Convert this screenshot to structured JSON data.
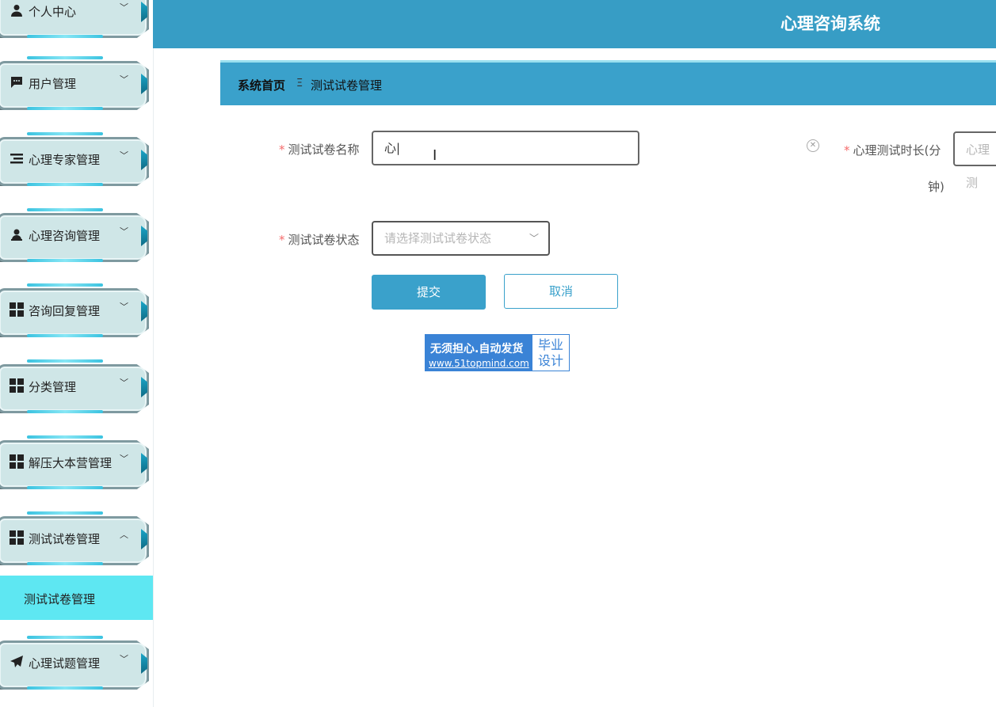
{
  "header": {
    "title": "心理咨询系统"
  },
  "breadcrumb": {
    "home": "系统首页",
    "separator": "Ξ",
    "current": "测试试卷管理"
  },
  "sidebar": {
    "items": [
      {
        "label": "个人中心",
        "icon": "person-icon",
        "arrow": "﹀"
      },
      {
        "label": "用户管理",
        "icon": "chat-icon",
        "arrow": "﹀"
      },
      {
        "label": "心理专家管理",
        "icon": "list-icon",
        "arrow": "﹀"
      },
      {
        "label": "心理咨询管理",
        "icon": "user-badge-icon",
        "arrow": "﹀"
      },
      {
        "label": "咨询回复管理",
        "icon": "grid-icon",
        "arrow": "﹀"
      },
      {
        "label": "分类管理",
        "icon": "grid-icon",
        "arrow": "﹀"
      },
      {
        "label": "解压大本营管理",
        "icon": "grid-icon",
        "arrow": "﹀"
      },
      {
        "label": "测试试卷管理",
        "icon": "grid-icon",
        "arrow": "︿"
      },
      {
        "label": "心理试题管理",
        "icon": "send-icon",
        "arrow": "﹀"
      }
    ],
    "sub_item": "测试试卷管理"
  },
  "form": {
    "name_label": "测试试卷名称",
    "name_value": "心|",
    "duration_label_line1": "心理测试时长(分",
    "duration_label_line2": "钟)",
    "duration_placeholder": "心理测",
    "status_label": "测试试卷状态",
    "status_placeholder": "请选择测试试卷状态",
    "required_mark": "*"
  },
  "buttons": {
    "submit": "提交",
    "cancel": "取消"
  },
  "ad": {
    "line1": "无须担心.自动发货",
    "line2": "www.51topmind.com",
    "right_line1": "毕业",
    "right_line2": "设计"
  },
  "colors": {
    "header": "#379dc5",
    "accent": "#3aa1cb",
    "active_sub": "#5ee7f2"
  }
}
